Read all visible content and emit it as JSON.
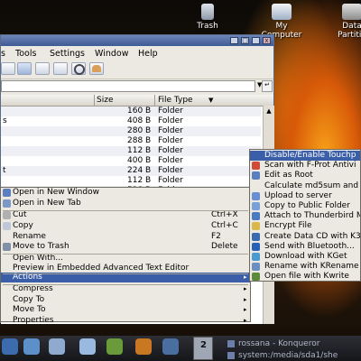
{
  "desktop_icons": [
    {
      "label": "Trash",
      "icon": "trash-icon"
    },
    {
      "label": "My\nComputer",
      "icon": "computer-icon"
    },
    {
      "label": "Data\nPartitio",
      "icon": "drive-icon"
    }
  ],
  "menubar": [
    "s",
    "Tools",
    "Settings",
    "Window",
    "Help"
  ],
  "columns": {
    "size": "Size",
    "type": "File Type"
  },
  "rows": [
    {
      "name": "",
      "size": "160 B",
      "type": "Folder"
    },
    {
      "name": "s",
      "size": "408 B",
      "type": "Folder"
    },
    {
      "name": "",
      "size": "280 B",
      "type": "Folder"
    },
    {
      "name": "",
      "size": "288 B",
      "type": "Folder"
    },
    {
      "name": "",
      "size": "112 B",
      "type": "Folder"
    },
    {
      "name": "",
      "size": "400 B",
      "type": "Folder"
    },
    {
      "name": "t",
      "size": "224 B",
      "type": "Folder"
    },
    {
      "name": "",
      "size": "112 B",
      "type": "Folder"
    },
    {
      "name": "",
      "size": "528 B",
      "type": "Folder"
    }
  ],
  "context_menu": {
    "items": [
      {
        "label": "Open in New Window",
        "shortcut": "",
        "icon": "window-icon"
      },
      {
        "label": "Open in New Tab",
        "shortcut": "",
        "icon": "tab-icon"
      },
      {
        "label": "Cut",
        "shortcut": "Ctrl+X",
        "icon": "cut-icon"
      },
      {
        "label": "Copy",
        "shortcut": "Ctrl+C",
        "icon": "copy-icon"
      },
      {
        "label": "Rename",
        "shortcut": "F2",
        "icon": ""
      },
      {
        "label": "Move to Trash",
        "shortcut": "Delete",
        "icon": "trash-icon"
      },
      {
        "label": "Open With...",
        "shortcut": "",
        "icon": ""
      },
      {
        "label": "Preview in Embedded Advanced Text Editor",
        "shortcut": "",
        "icon": ""
      },
      {
        "label": "Actions",
        "shortcut": "",
        "icon": ""
      },
      {
        "label": "Compress",
        "shortcut": "",
        "icon": ""
      },
      {
        "label": "Copy To",
        "shortcut": "",
        "icon": ""
      },
      {
        "label": "Move To",
        "shortcut": "",
        "icon": ""
      },
      {
        "label": "Properties",
        "shortcut": "",
        "icon": ""
      }
    ]
  },
  "actions_submenu": [
    "Disable/Enable Touchp",
    "Scan with F-Prot Antivi",
    "Edit as Root",
    "Calculate md5sum and",
    "Upload to server",
    "Copy to Public Folder",
    "Attach to Thunderbird M",
    "Encrypt File",
    "Create Data CD with K3",
    "Send with Bluetooth...",
    "Download with KGet",
    "Rename with KRename",
    "Open file with Kwrite"
  ],
  "taskbar": {
    "pager": "2",
    "tasks": [
      "rossana - Konqueror",
      "system:/media/sda1/she"
    ]
  },
  "colors": {
    "highlight": "#3b5ea8",
    "menu_bg": "#ece9e2",
    "title": "#3e5a94"
  }
}
